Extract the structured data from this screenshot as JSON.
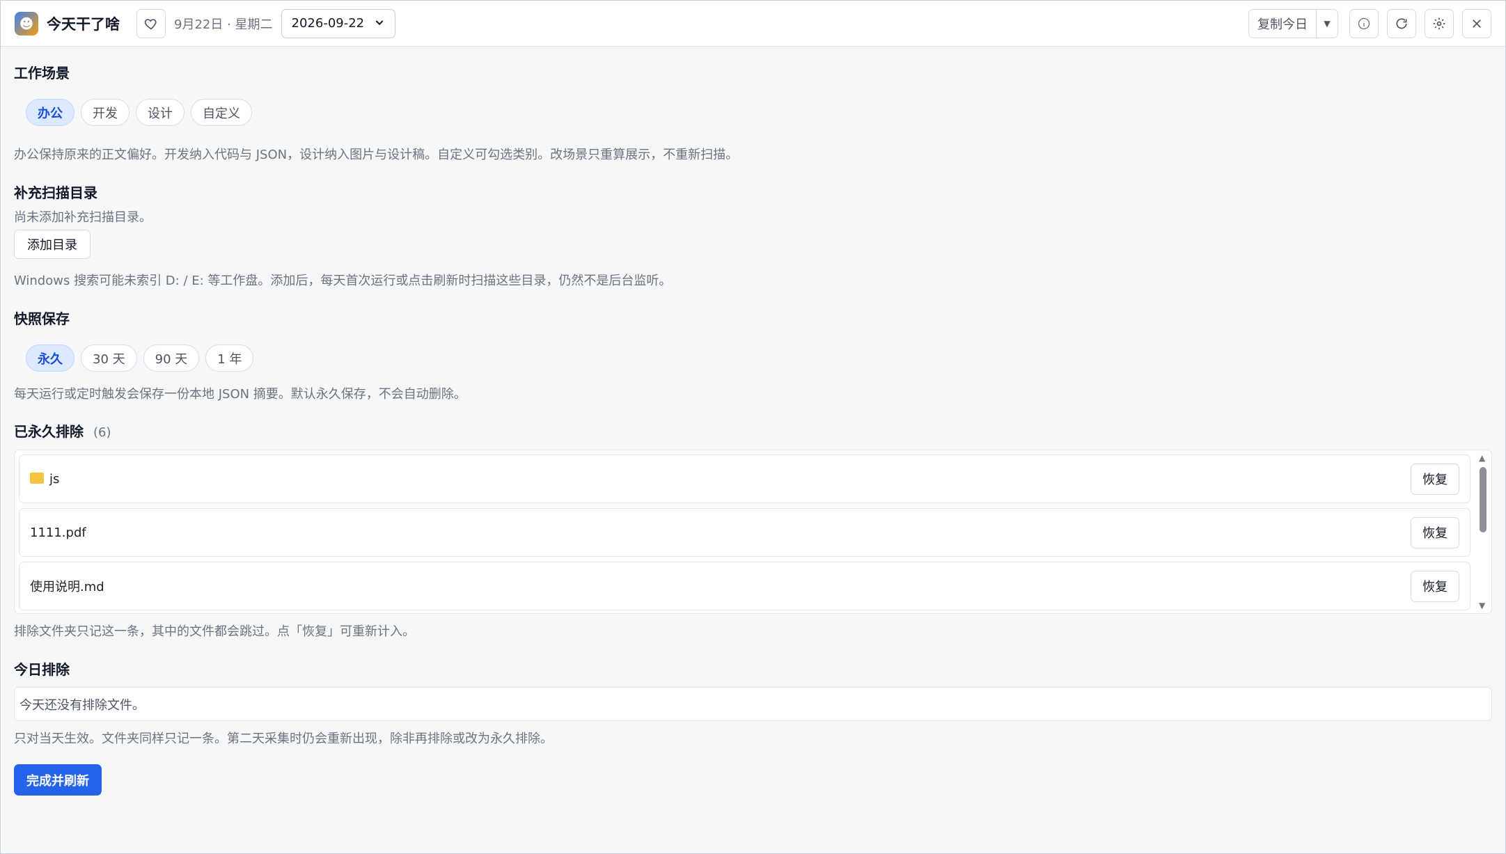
{
  "header": {
    "app_title": "今天干了啥",
    "date_text": "9月22日 · 星期二",
    "date_value": "2026-09-22",
    "copy_label": "复制今日"
  },
  "scene": {
    "title": "工作场景",
    "pills": [
      "办公",
      "开发",
      "设计",
      "自定义"
    ],
    "active": "办公",
    "help": "办公保持原来的正文偏好。开发纳入代码与 JSON，设计纳入图片与设计稿。自定义可勾选类别。改场景只重算展示，不重新扫描。"
  },
  "scan_dirs": {
    "title": "补充扫描目录",
    "empty_text": "尚未添加补充扫描目录。",
    "add_label": "添加目录",
    "help": "Windows 搜索可能未索引 D: / E: 等工作盘。添加后，每天首次运行或点击刷新时扫描这些目录，仍然不是后台监听。"
  },
  "snapshot": {
    "title": "快照保存",
    "pills": [
      "永久",
      "30 天",
      "90 天",
      "1 年"
    ],
    "active": "永久",
    "help": "每天运行或定时触发会保存一份本地 JSON 摘要。默认永久保存，不会自动删除。"
  },
  "permanent_excluded": {
    "title": "已永久排除",
    "count": "(6)",
    "items": [
      {
        "name": "js",
        "is_folder": true,
        "restore_label": "恢复"
      },
      {
        "name": "1111.pdf",
        "is_folder": false,
        "restore_label": "恢复"
      },
      {
        "name": "使用说明.md",
        "is_folder": false,
        "restore_label": "恢复"
      }
    ],
    "help": "排除文件夹只记这一条，其中的文件都会跳过。点「恢复」可重新计入。"
  },
  "today_excluded": {
    "title": "今日排除",
    "empty_text": "今天还没有排除文件。",
    "help": "只对当天生效。文件夹同样只记一条。第二天采集时仍会重新出现，除非再排除或改为永久排除。"
  },
  "finish_label": "完成并刷新",
  "colors": {
    "accent": "#2563eb",
    "pill_active_bg": "#dbeafe"
  }
}
